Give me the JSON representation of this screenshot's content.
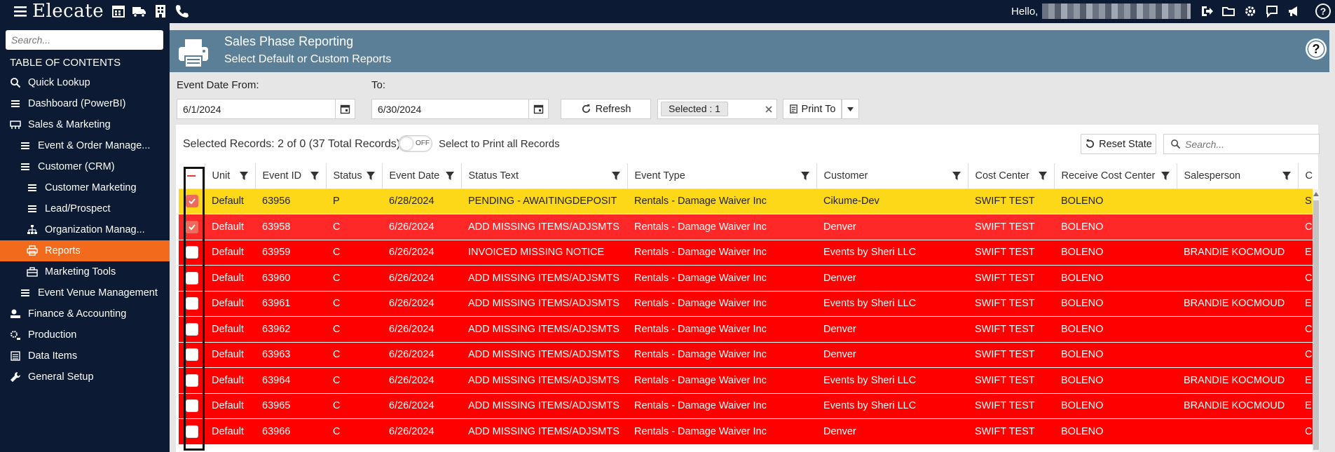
{
  "app": {
    "name": "Elecate",
    "hello": "Hello,"
  },
  "sidebar": {
    "search_placeholder": "Search...",
    "toc_label": "TABLE OF CONTENTS",
    "items": [
      {
        "label": "Quick Lookup",
        "icon": "search-icon"
      },
      {
        "label": "Dashboard (PowerBI)",
        "icon": "menu-icon"
      },
      {
        "label": "Sales & Marketing",
        "icon": "presentation-icon"
      },
      {
        "label": "Event & Order Manage...",
        "icon": "menu-icon"
      },
      {
        "label": "Customer (CRM)",
        "icon": "menu-icon"
      },
      {
        "label": "Customer Marketing",
        "icon": "menu-icon"
      },
      {
        "label": "Lead/Prospect",
        "icon": "menu-icon"
      },
      {
        "label": "Organization Manag...",
        "icon": "org-chart-icon"
      },
      {
        "label": "Reports",
        "icon": "printer-icon",
        "active": true
      },
      {
        "label": "Marketing Tools",
        "icon": "toolbox-icon"
      },
      {
        "label": "Event Venue Management",
        "icon": "menu-icon"
      },
      {
        "label": "Finance & Accounting",
        "icon": "money-icon"
      },
      {
        "label": "Production",
        "icon": "production-icon"
      },
      {
        "label": "Data Items",
        "icon": "list-icon"
      },
      {
        "label": "General Setup",
        "icon": "wrench-icon"
      }
    ]
  },
  "header": {
    "title": "Sales Phase Reporting",
    "subtitle": "Select Default or Custom Reports"
  },
  "filters": {
    "from_label": "Event Date From:",
    "from_value": "6/1/2024",
    "to_label": "To:",
    "to_value": "6/30/2024",
    "refresh_label": "Refresh",
    "selected_label": "Selected : 1",
    "print_label": "Print To"
  },
  "grid": {
    "selected_text": "Selected Records: 2 of 0 (37 Total Records)",
    "toggle_text": "OFF",
    "print_all_text": "Select to Print all Records",
    "reset_label": "Reset State",
    "search_placeholder": "Search...",
    "columns": [
      "Unit",
      "Event ID",
      "Status",
      "Event Date",
      "Status Text",
      "Event Type",
      "Customer",
      "Cost Center",
      "Receive Cost Center",
      "Salesperson",
      "C"
    ],
    "rows": [
      {
        "checked": true,
        "color": "yellow",
        "cells": [
          "Default",
          "63956",
          "P",
          "6/28/2024",
          "PENDING - AWAITINGDEPOSIT",
          "Rentals - Damage Waiver Inc",
          "Cikume-Dev",
          "SWIFT TEST",
          "BOLENO",
          "",
          "S"
        ]
      },
      {
        "checked": true,
        "color": "pink",
        "cells": [
          "Default",
          "63958",
          "C",
          "6/26/2024",
          "ADD MISSING ITEMS/ADJSMTS",
          "Rentals - Damage Waiver Inc",
          "Denver",
          "SWIFT TEST",
          "BOLENO",
          "",
          "C"
        ]
      },
      {
        "checked": false,
        "color": "red",
        "cells": [
          "Default",
          "63959",
          "C",
          "6/26/2024",
          "INVOICED MISSING NOTICE",
          "Rentals - Damage Waiver Inc",
          "Events by Sheri LLC",
          "SWIFT TEST",
          "BOLENO",
          "BRANDIE KOCMOUD",
          "E"
        ]
      },
      {
        "checked": false,
        "color": "red",
        "cells": [
          "Default",
          "63960",
          "C",
          "6/26/2024",
          "ADD MISSING ITEMS/ADJSMTS",
          "Rentals - Damage Waiver Inc",
          "Denver",
          "SWIFT TEST",
          "BOLENO",
          "",
          "C"
        ]
      },
      {
        "checked": false,
        "color": "red",
        "cells": [
          "Default",
          "63961",
          "C",
          "6/26/2024",
          "ADD MISSING ITEMS/ADJSMTS",
          "Rentals - Damage Waiver Inc",
          "Events by Sheri LLC",
          "SWIFT TEST",
          "BOLENO",
          "BRANDIE KOCMOUD",
          "E"
        ]
      },
      {
        "checked": false,
        "color": "red",
        "cells": [
          "Default",
          "63962",
          "C",
          "6/26/2024",
          "ADD MISSING ITEMS/ADJSMTS",
          "Rentals - Damage Waiver Inc",
          "Denver",
          "SWIFT TEST",
          "BOLENO",
          "",
          "C"
        ]
      },
      {
        "checked": false,
        "color": "red",
        "cells": [
          "Default",
          "63963",
          "C",
          "6/26/2024",
          "ADD MISSING ITEMS/ADJSMTS",
          "Rentals - Damage Waiver Inc",
          "Denver",
          "SWIFT TEST",
          "BOLENO",
          "",
          "C"
        ]
      },
      {
        "checked": false,
        "color": "red",
        "cells": [
          "Default",
          "63964",
          "C",
          "6/26/2024",
          "ADD MISSING ITEMS/ADJSMTS",
          "Rentals - Damage Waiver Inc",
          "Events by Sheri LLC",
          "SWIFT TEST",
          "BOLENO",
          "BRANDIE KOCMOUD",
          "E"
        ]
      },
      {
        "checked": false,
        "color": "red",
        "cells": [
          "Default",
          "63965",
          "C",
          "6/26/2024",
          "ADD MISSING ITEMS/ADJSMTS",
          "Rentals - Damage Waiver Inc",
          "Events by Sheri LLC",
          "SWIFT TEST",
          "BOLENO",
          "BRANDIE KOCMOUD",
          "E"
        ]
      },
      {
        "checked": false,
        "color": "red",
        "cells": [
          "Default",
          "63966",
          "C",
          "6/26/2024",
          "ADD MISSING ITEMS/ADJSMTS",
          "Rentals - Damage Waiver Inc",
          "Denver",
          "SWIFT TEST",
          "BOLENO",
          "",
          "C"
        ]
      }
    ]
  },
  "colors": {
    "topbar": "#0c1a33",
    "accent": "#f26a1b",
    "header": "#5c7f98",
    "row_yellow": "#fdd819",
    "row_pink": "#ff2828",
    "row_red": "#ff0000"
  }
}
